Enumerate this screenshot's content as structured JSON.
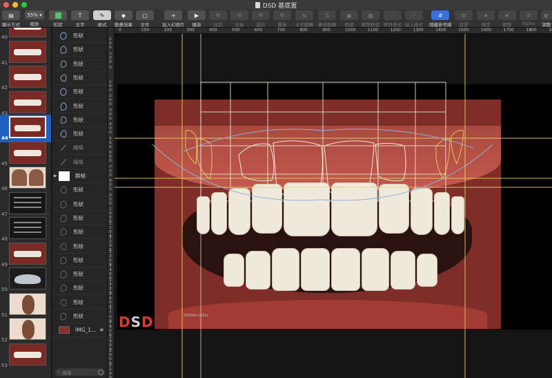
{
  "window": {
    "title": "DSD 基底置"
  },
  "toolbar": {
    "zoom_value": "55%",
    "items": [
      {
        "label": "顯示方式"
      },
      {
        "label": "縮放"
      },
      {
        "label": "形狀"
      },
      {
        "label": "文字"
      },
      {
        "label": "格式"
      },
      {
        "label": "動畫效果"
      },
      {
        "label": "文件"
      },
      {
        "label": "加入幻燈片"
      },
      {
        "label": "播放"
      },
      {
        "label": "往前"
      },
      {
        "label": "往後"
      },
      {
        "label": "最前"
      },
      {
        "label": "最後"
      },
      {
        "label": "水平翻轉"
      },
      {
        "label": "垂直翻轉"
      },
      {
        "label": "群組"
      },
      {
        "label": "解散群組"
      },
      {
        "label": "拷貝樣式"
      },
      {
        "label": "貼上樣式"
      },
      {
        "label": "隱藏參考線"
      },
      {
        "label": "遮罩"
      },
      {
        "label": "鎖定"
      },
      {
        "label": "解鎖"
      },
      {
        "label": "Alpha"
      },
      {
        "label": "調整"
      }
    ]
  },
  "navigator": {
    "slides": [
      {
        "number": "40",
        "kind": "smile"
      },
      {
        "number": "41",
        "kind": "smile"
      },
      {
        "number": "42",
        "kind": "smile"
      },
      {
        "number": "43",
        "kind": "smile"
      },
      {
        "number": "44",
        "kind": "smile",
        "selected": true
      },
      {
        "number": "45",
        "kind": "smile"
      },
      {
        "number": "46",
        "kind": "faces"
      },
      {
        "number": "47",
        "kind": "dark"
      },
      {
        "number": "48",
        "kind": "dark"
      },
      {
        "number": "49",
        "kind": "smile"
      },
      {
        "number": "50",
        "kind": "tray"
      },
      {
        "number": "51",
        "kind": "face"
      },
      {
        "number": "52",
        "kind": "face"
      },
      {
        "number": "53",
        "kind": "smile"
      }
    ]
  },
  "layers": {
    "items": [
      {
        "label": "形狀",
        "type": "shape"
      },
      {
        "label": "形狀",
        "type": "shape"
      },
      {
        "label": "形狀",
        "type": "shape"
      },
      {
        "label": "形狀",
        "type": "shape"
      },
      {
        "label": "形狀",
        "type": "shape"
      },
      {
        "label": "形狀",
        "type": "shape"
      },
      {
        "label": "形狀",
        "type": "shape"
      },
      {
        "label": "形狀",
        "type": "shape"
      },
      {
        "label": "線條",
        "type": "line"
      },
      {
        "label": "線條",
        "type": "line"
      },
      {
        "label": "群組",
        "type": "group"
      },
      {
        "label": "形狀",
        "type": "shape"
      },
      {
        "label": "形狀",
        "type": "shape"
      },
      {
        "label": "形狀",
        "type": "shape"
      },
      {
        "label": "形狀",
        "type": "shape"
      },
      {
        "label": "形狀",
        "type": "shape"
      },
      {
        "label": "形狀",
        "type": "shape"
      },
      {
        "label": "形狀",
        "type": "shape"
      },
      {
        "label": "形狀",
        "type": "shape"
      },
      {
        "label": "形狀",
        "type": "shape"
      },
      {
        "label": "形狀",
        "type": "shape"
      },
      {
        "label": "IMG_1...",
        "type": "image"
      }
    ],
    "search_placeholder": "搜尋"
  },
  "ruler": {
    "h_ticks": [
      "0",
      "100",
      "200",
      "300",
      "400",
      "500",
      "600",
      "700",
      "800",
      "900",
      "1000",
      "1100",
      "1200",
      "1300",
      "1400",
      "1500",
      "1600",
      "1700",
      "1800",
      "1900"
    ],
    "v_ticks": [
      "200",
      "100",
      "0",
      "100",
      "200",
      "300",
      "400",
      "500",
      "600",
      "700",
      "800",
      "900",
      "1000",
      "1100",
      "1200",
      "1300",
      "1400",
      "1500",
      "1600",
      "1700",
      "1800",
      "1900",
      "2000",
      "2100"
    ]
  },
  "logo": {
    "text_d1": "D",
    "text_s": "S",
    "text_d2": "D",
    "signature": "STEFAN SHELL"
  }
}
